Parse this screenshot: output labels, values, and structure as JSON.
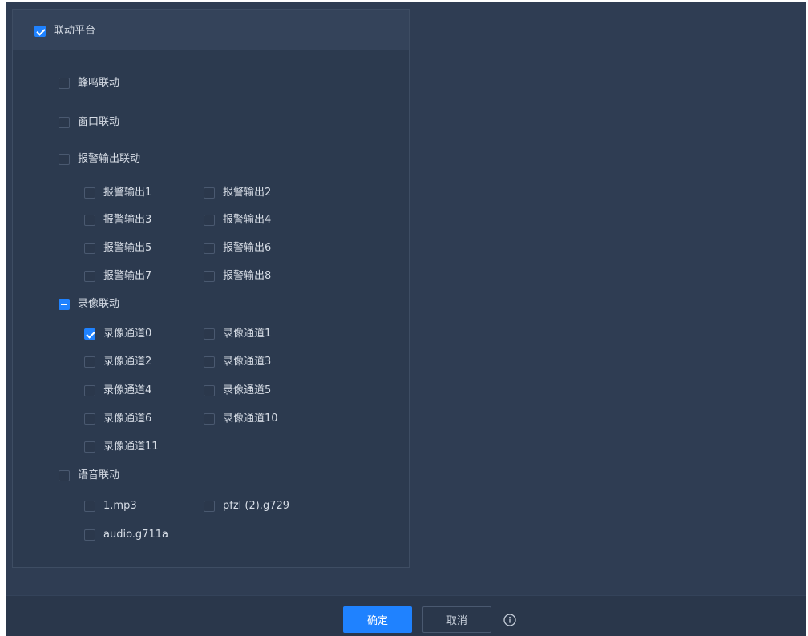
{
  "linkage": {
    "header_label": "联动平台",
    "buzzer_label": "蜂鸣联动",
    "window_label": "窗口联动",
    "alarm_output": {
      "label": "报警输出联动",
      "items": [
        "报警输出1",
        "报警输出2",
        "报警输出3",
        "报警输出4",
        "报警输出5",
        "报警输出6",
        "报警输出7",
        "报警输出8"
      ]
    },
    "record": {
      "label": "录像联动",
      "items": [
        "录像通道0",
        "录像通道1",
        "录像通道2",
        "录像通道3",
        "录像通道4",
        "录像通道5",
        "录像通道6",
        "录像通道10",
        "录像通道11"
      ]
    },
    "audio": {
      "label": "语音联动",
      "items": [
        "1.mp3",
        "pfzl (2).g729",
        "audio.g711a"
      ]
    }
  },
  "states": {
    "platform": "checked",
    "buzzer": "unchecked",
    "window": "unchecked",
    "alarm_output": "unchecked",
    "record": "indeterminate",
    "record_channel_0": "checked",
    "audio": "unchecked"
  },
  "footer": {
    "ok_label": "确定",
    "cancel_label": "取消",
    "info_icon": "info-circle-icon"
  },
  "colors": {
    "accent": "#1f82ff",
    "background": "#2f3d53",
    "panel": "#2c3a4f"
  }
}
